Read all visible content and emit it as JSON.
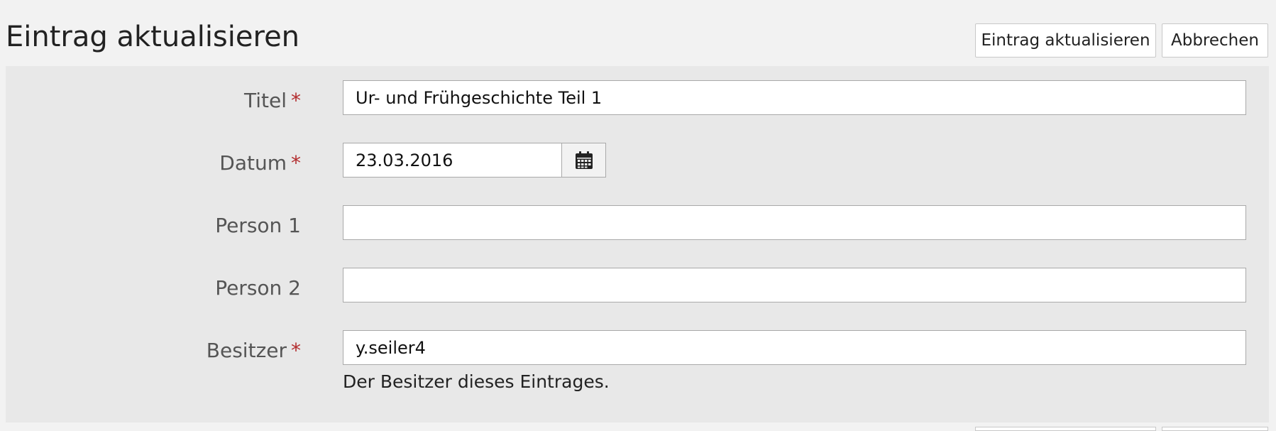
{
  "header": {
    "title": "Eintrag aktualisieren",
    "update_label": "Eintrag aktualisieren",
    "cancel_label": "Abbrechen"
  },
  "form": {
    "required_marker": "*",
    "fields": [
      {
        "label": "Titel",
        "value": "Ur- und Frühgeschichte Teil 1",
        "required": true
      },
      {
        "label": "Datum",
        "value": "23.03.2016",
        "required": true,
        "icon": "calendar-icon"
      },
      {
        "label": "Person 1",
        "value": "",
        "required": false
      },
      {
        "label": "Person 2",
        "value": "",
        "required": false
      },
      {
        "label": "Besitzer",
        "value": "y.seiler4",
        "required": true,
        "help": "Der Besitzer dieses Eintrages."
      }
    ]
  },
  "colors": {
    "required": "#b32d2e",
    "panel_bg": "#e8e8e8",
    "page_bg": "#f2f2f2"
  }
}
